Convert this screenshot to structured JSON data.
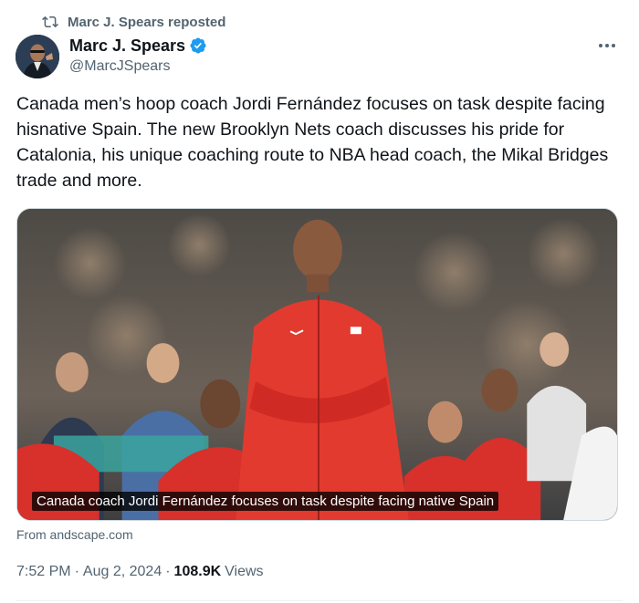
{
  "repost": {
    "label": "Marc J. Spears reposted",
    "icon": "repost-icon"
  },
  "author": {
    "name": "Marc J. Spears",
    "handle": "@MarcJSpears",
    "verified": true,
    "verified_color": "#1d9bf0"
  },
  "menu": {
    "icon": "more-dots-icon"
  },
  "tweet": {
    "text": "Canada men’s hoop coach Jordi Fernández focuses on task despite facing  hisnative Spain. The new Brooklyn Nets coach discusses his pride for Catalonia, his unique coaching route to NBA head coach, the Mikal Bridges trade and more."
  },
  "media": {
    "caption": "Canada coach Jordi Fernández focuses on task despite facing native Spain",
    "source": "From andscape.com"
  },
  "meta": {
    "time": "7:52 PM",
    "date": "Aug 2, 2024",
    "views_count": "108.9K",
    "views_label": "Views"
  },
  "colors": {
    "text": "#0f1419",
    "secondary": "#536471",
    "jacket_red": "#d8302b"
  }
}
